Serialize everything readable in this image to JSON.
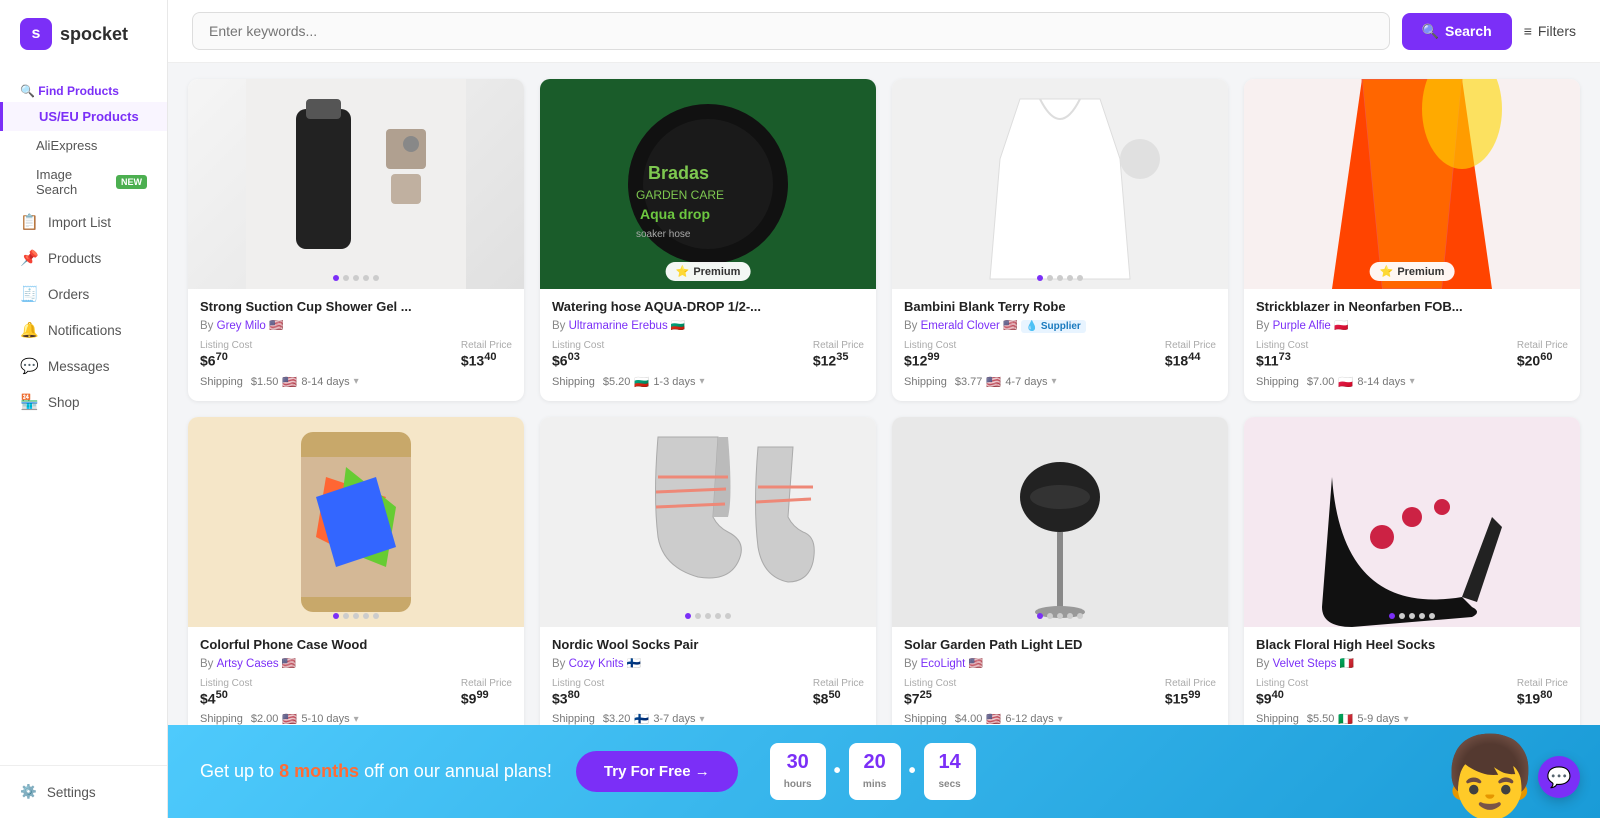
{
  "app": {
    "name": "spocket"
  },
  "search": {
    "placeholder": "Enter keywords...",
    "button_label": "Search",
    "filters_label": "Filters"
  },
  "sidebar": {
    "logo": "spocket",
    "sections": [
      {
        "id": "find-products",
        "label": "Find Products",
        "icon": "🔍",
        "active": true
      }
    ],
    "sub_items": [
      {
        "id": "us-eu",
        "label": "US/EU Products",
        "active": true
      },
      {
        "id": "aliexpress",
        "label": "AliExpress"
      },
      {
        "id": "image-search",
        "label": "Image Search",
        "badge": "NEW"
      }
    ],
    "nav_items": [
      {
        "id": "import-list",
        "label": "Import List",
        "icon": "📋"
      },
      {
        "id": "products",
        "label": "Products",
        "icon": "📌"
      },
      {
        "id": "orders",
        "label": "Orders",
        "icon": "🧾"
      },
      {
        "id": "notifications",
        "label": "Notifications",
        "icon": "🔔"
      },
      {
        "id": "messages",
        "label": "Messages",
        "icon": "💬"
      },
      {
        "id": "shop",
        "label": "Shop",
        "icon": "🏪"
      }
    ],
    "bottom_items": [
      {
        "id": "settings",
        "label": "Settings",
        "icon": "⚙️"
      }
    ]
  },
  "products": [
    {
      "id": 1,
      "title": "Strong Suction Cup Shower Gel ...",
      "seller": "Grey Milo",
      "seller_flag": "🇺🇸",
      "listing_cost": "6",
      "listing_cents": "70",
      "retail_price": "13",
      "retail_cents": "40",
      "shipping_cost": "1.50",
      "shipping_flag": "🇺🇸",
      "shipping_days": "8-14 days",
      "premium": false,
      "img_type": "shower"
    },
    {
      "id": 2,
      "title": "Watering hose AQUA-DROP 1/2-...",
      "seller": "Ultramarine Erebus",
      "seller_flag": "🇧🇬",
      "listing_cost": "6",
      "listing_cents": "03",
      "retail_price": "12",
      "retail_cents": "35",
      "shipping_cost": "5.20",
      "shipping_flag": "🇧🇬",
      "shipping_days": "1-3 days",
      "premium": true,
      "img_type": "hose"
    },
    {
      "id": 3,
      "title": "Bambini Blank Terry Robe",
      "seller": "Emerald Clover",
      "seller_flag": "🇺🇸",
      "has_supplier": true,
      "listing_cost": "12",
      "listing_cents": "99",
      "retail_price": "18",
      "retail_cents": "44",
      "shipping_cost": "3.77",
      "shipping_flag": "🇺🇸",
      "shipping_days": "4-7 days",
      "premium": false,
      "img_type": "robe"
    },
    {
      "id": 4,
      "title": "Strickblazer in Neonfarben FOB...",
      "seller": "Purple Alfie",
      "seller_flag": "🇵🇱",
      "listing_cost": "11",
      "listing_cents": "73",
      "retail_price": "20",
      "retail_cents": "60",
      "shipping_cost": "7.00",
      "shipping_flag": "🇵🇱",
      "shipping_days": "8-14 days",
      "premium": true,
      "img_type": "blazer"
    },
    {
      "id": 5,
      "title": "Colorful Phone Case Wood",
      "seller": "Artsy Cases",
      "seller_flag": "🇺🇸",
      "listing_cost": "4",
      "listing_cents": "50",
      "retail_price": "9",
      "retail_cents": "99",
      "shipping_cost": "2.00",
      "shipping_flag": "🇺🇸",
      "shipping_days": "5-10 days",
      "premium": false,
      "img_type": "phone"
    },
    {
      "id": 6,
      "title": "Nordic Wool Socks Pair",
      "seller": "Cozy Knits",
      "seller_flag": "🇫🇮",
      "listing_cost": "3",
      "listing_cents": "80",
      "retail_price": "8",
      "retail_cents": "50",
      "shipping_cost": "3.20",
      "shipping_flag": "🇫🇮",
      "shipping_days": "3-7 days",
      "premium": false,
      "img_type": "socks"
    },
    {
      "id": 7,
      "title": "Solar Garden Path Light LED",
      "seller": "EcoLight",
      "seller_flag": "🇺🇸",
      "listing_cost": "7",
      "listing_cents": "25",
      "retail_price": "15",
      "retail_cents": "99",
      "shipping_cost": "4.00",
      "shipping_flag": "🇺🇸",
      "shipping_days": "6-12 days",
      "premium": false,
      "img_type": "lamp"
    },
    {
      "id": 8,
      "title": "Black Floral High Heel Socks",
      "seller": "Velvet Steps",
      "seller_flag": "🇮🇹",
      "listing_cost": "9",
      "listing_cents": "40",
      "retail_price": "19",
      "retail_cents": "80",
      "shipping_cost": "5.50",
      "shipping_flag": "🇮🇹",
      "shipping_days": "5-9 days",
      "premium": false,
      "img_type": "heels"
    }
  ],
  "promo": {
    "text_prefix": "Get up to ",
    "highlight": "8 months",
    "text_suffix": " off on our annual plans!",
    "button_label": "Try For Free →",
    "countdown": {
      "hours": "30",
      "hours_label": "hours",
      "mins": "20",
      "mins_label": "mins",
      "secs": "14",
      "secs_label": "secs"
    }
  }
}
